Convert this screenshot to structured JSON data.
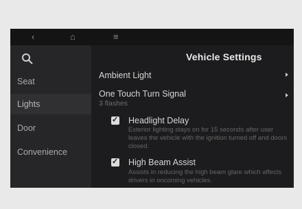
{
  "topbar": {
    "back_icon": "‹",
    "home_icon": "⌂",
    "menu_icon": "≡"
  },
  "sidebar": {
    "items": [
      {
        "label": "Seat"
      },
      {
        "label": "Lights"
      },
      {
        "label": "Door"
      },
      {
        "label": "Convenience"
      }
    ]
  },
  "main": {
    "title": "Vehicle Settings",
    "rows": [
      {
        "label": "Ambient Light"
      },
      {
        "label": "One Touch Turn Signal",
        "sub": "3 flashes"
      }
    ],
    "options": [
      {
        "label": "Headlight Delay",
        "checked": true,
        "description": "Exterior lighting stays on for 15 seconds after user leaves the vehicle with the ignition turned off and doors closed."
      },
      {
        "label": "High Beam Assist",
        "checked": true,
        "description": "Assists in reducing the high beam glare which affects drivers in oncoming vehicles."
      }
    ]
  }
}
